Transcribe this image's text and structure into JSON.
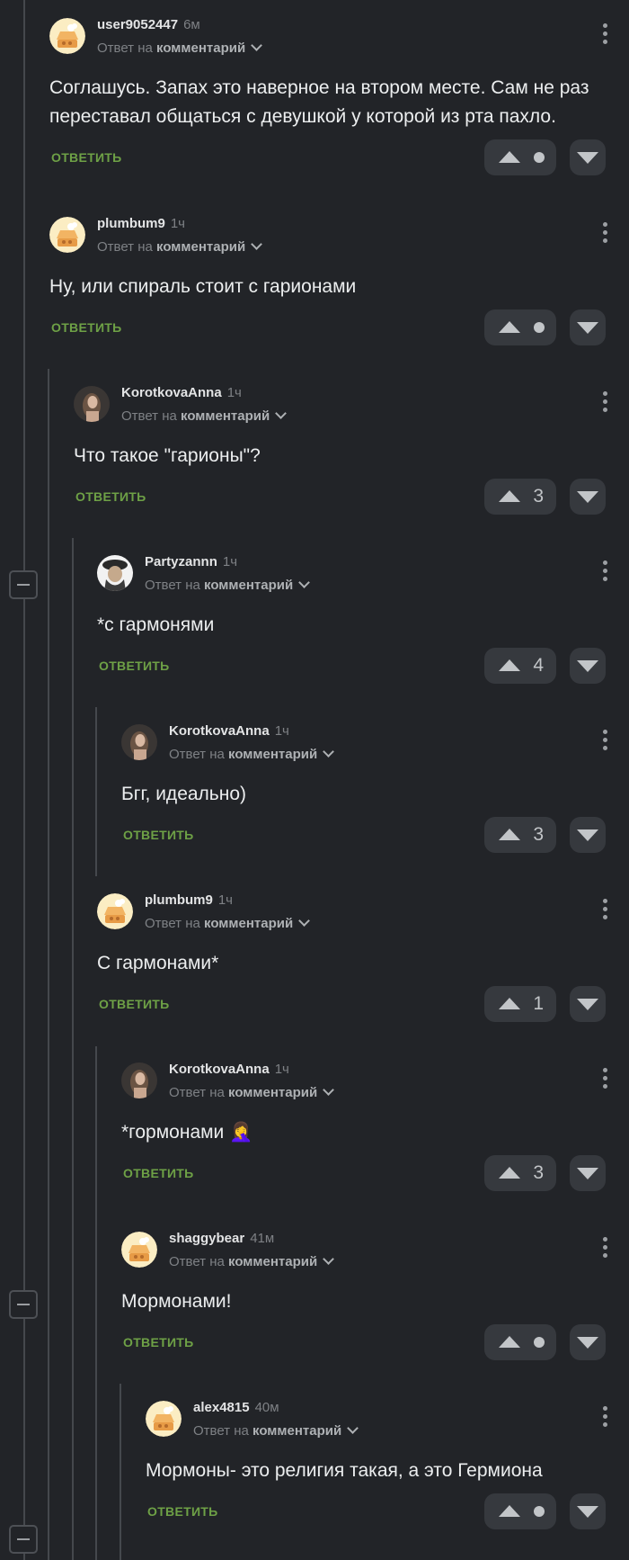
{
  "reply_label": "ОТВЕТИТЬ",
  "reply_to_prefix": "Ответ на",
  "reply_to_target": "комментарий",
  "comments": [
    {
      "author": "user9052447",
      "time": "6м",
      "text": "Соглашусь. Запах это наверное на втором месте. Сам не раз переставал общаться с девушкой у которой из рта пахло.",
      "rating": "",
      "avatar": "default"
    },
    {
      "author": "plumbum9",
      "time": "1ч",
      "text": "Ну, или спираль стоит с гарионами",
      "rating": "",
      "avatar": "default"
    },
    {
      "author": "KorotkovaAnna",
      "time": "1ч",
      "text": "Что такое \"гарионы\"?",
      "rating": "3",
      "avatar": "photo-girl"
    },
    {
      "author": "Partyzannn",
      "time": "1ч",
      "text": "*с гармонями",
      "rating": "4",
      "avatar": "photo-man"
    },
    {
      "author": "KorotkovaAnna",
      "time": "1ч",
      "text": "Бгг, идеально)",
      "rating": "3",
      "avatar": "photo-girl"
    },
    {
      "author": "plumbum9",
      "time": "1ч",
      "text": "С гармонами*",
      "rating": "1",
      "avatar": "default"
    },
    {
      "author": "KorotkovaAnna",
      "time": "1ч",
      "text": "*гормонами 🤦‍♀️",
      "rating": "3",
      "avatar": "photo-girl"
    },
    {
      "author": "shaggybear",
      "time": "41м",
      "text": "Мормонами!",
      "rating": "",
      "avatar": "default"
    },
    {
      "author": "alex4815",
      "time": "40м",
      "text": "Мормоны- это религия такая, а это Гермиона",
      "rating": "",
      "avatar": "default"
    }
  ],
  "colors": {
    "background": "#222428",
    "reply": "#6ea146",
    "button": "#36393e"
  }
}
